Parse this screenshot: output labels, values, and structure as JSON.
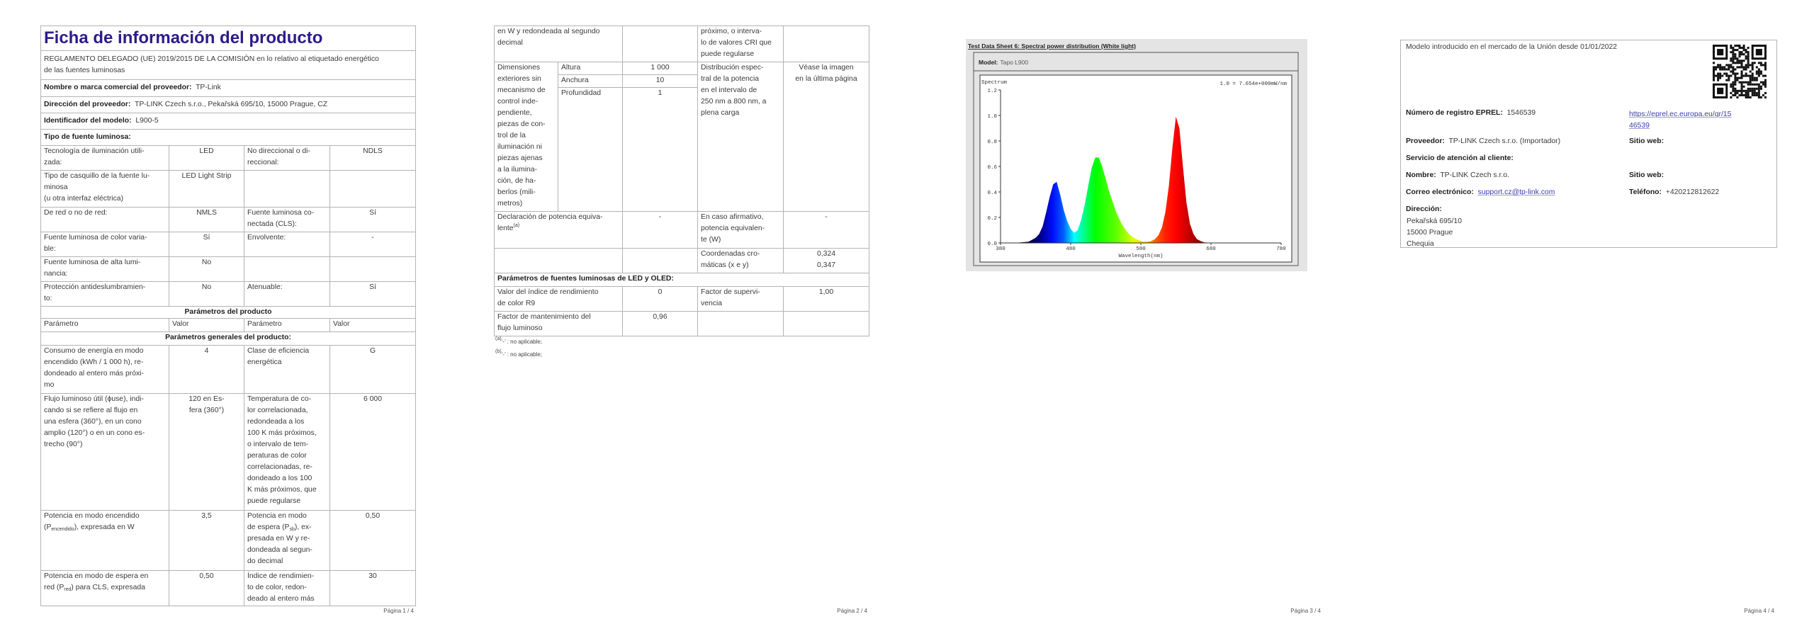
{
  "p1": {
    "title": "Ficha de información del producto",
    "regulation": "REGLAMENTO DELEGADO (UE) 2019/2015 DE LA COMISIÓN en lo relativo al etiquetado energético\nde las fuentes luminosas",
    "supplier_label": "Nombre o marca comercial del proveedor:",
    "supplier": "TP-Link",
    "address_label": "Dirección del proveedor:",
    "address": "TP-LINK Czech s.r.o., Pekařská 695/10, 15000 Prague, CZ",
    "model_label": "Identificador del modelo:",
    "model": "L900-5",
    "type_label": "Tipo de fuente luminosa:",
    "type_rows": [
      [
        "Tecnología de iluminación utili-\nzada:",
        "LED",
        "No direccional o di-\nreccional:",
        "NDLS"
      ],
      [
        "Tipo de casquillo de la fuente lu-\nminosa\n(u otra interfaz eléctrica)",
        "LED Light Strip",
        "",
        ""
      ],
      [
        "De red o no de red:",
        "NMLS",
        "Fuente luminosa co-\nnectada (CLS):",
        "Sí"
      ],
      [
        "Fuente luminosa de color varia-\nble:",
        "Sí",
        "Envolvente:",
        "-"
      ],
      [
        "Fuente luminosa de alta lumi-\nnancia:",
        "No",
        "",
        ""
      ],
      [
        "Protección antideslumbramien-\nto:",
        "No",
        "Atenuable:",
        "Sí"
      ]
    ],
    "params_title": "Parámetros del producto",
    "params_header": [
      "Parámetro",
      "Valor",
      "Parámetro",
      "Valor"
    ],
    "general_title": "Parámetros generales del producto:",
    "general_rows": [
      [
        "Consumo de energía en modo\nencendido (kWh / 1 000 h), re-\ndondeado al entero más próxi-\nmo",
        "4",
        "Clase de eficiencia\nenergética",
        "G"
      ],
      [
        "Flujo luminoso útil (ϕuse), indi-\ncando si se refiere al flujo en\nuna esfera (360°), en un cono\namplio (120°) o en un cono es-\ntrecho (90°)",
        "120 en Es-\nfera (360°)",
        "Temperatura de co-\nlor correlacionada,\nredondeada a los\n100 K más próximos,\no intervalo de tem-\nperaturas de color\ncorrelacionadas, re-\ndondeado a los 100\nK más próximos, que\npuede regularse",
        "6 000"
      ],
      [
        {
          "pre": "Potencia en modo encendido\n(P",
          "sub": "encendido",
          "post": "), expresada en W"
        },
        "3,5",
        {
          "pre": "Potencia en modo\nde espera (P",
          "sub": "sb",
          "post": "), ex-\npresada en W y re-\ndondeada al segun-\ndo decimal"
        },
        "0,50"
      ],
      [
        {
          "pre": "Potencia en modo de espera en\nred (P",
          "sub": "red",
          "post": ") para CLS, expresada"
        },
        "0,50",
        "Índice de rendimien-\nto de color, redon-\ndeado al entero más",
        "30"
      ]
    ],
    "footer": "Página 1 / 4"
  },
  "p2": {
    "cont_row": [
      "en W y redondeada al segundo\ndecimal",
      "",
      "próximo, o interva-\nlo de valores CRI que\npuede regularse",
      ""
    ],
    "dimensions_label": "Dimensiones\nexteriores sin\nmecanismo de\ncontrol inde-\npendiente,\npiezas de con-\ntrol de la\niluminación ni\npiezas ajenas\na la ilumina-\nción, de ha-\nberlos (mili-\nmetros)",
    "dimensions": [
      {
        "label": "Altura",
        "value": "1 000"
      },
      {
        "label": "Anchura",
        "value": "10"
      },
      {
        "label": "Profundidad",
        "value": "1"
      }
    ],
    "spd_label": "Distribución espec-\ntral de la potencia\nen el intervalo de\n250 nm a 800 nm, a\nplena carga",
    "spd_value": "Véase la imagen\nen la última página",
    "equiv_label": "Declaración de potencia equiva-\nlente",
    "equiv_sup": "(a)",
    "equiv_value": "-",
    "equiv_w_label": "En caso afirmativo,\npotencia equivalen-\nte (W)",
    "equiv_w_value": "-",
    "chroma_label": "Coordenadas cro-\nmáticas (x e y)",
    "chroma_value": "0,324\n0,347",
    "led_title": "Parámetros de fuentes luminosas de LED y OLED:",
    "led_rows": [
      [
        "Valor del índice de rendimiento\nde color R9",
        "0",
        "Factor de supervi-\nvencia",
        "1,00"
      ],
      [
        "Factor de mantenimiento del\nflujo luminoso",
        "0,96",
        "",
        ""
      ]
    ],
    "footnotes": [
      {
        "mark": "(a)",
        "text": "‘-’ : no aplicable;"
      },
      {
        "mark": "(b)",
        "text": "‘-’ : no aplicable;"
      }
    ],
    "footer": "Página 2 / 4"
  },
  "p3": {
    "sheet_title": "Test Data Sheet 6: Spectral power distribution (White light)",
    "model_label": "Model:",
    "model_value": "Tapo L900",
    "footer": "Página 3 / 4"
  },
  "chart_data": {
    "type": "area",
    "title": "Spectrum",
    "annotation": "1.0 = 7.654e+000mW/nm",
    "xlabel": "Wavelength(nm)",
    "ylabel": "Spectrum",
    "xlim": [
      380,
      780
    ],
    "ylim": [
      0,
      1.2
    ],
    "xticks": [
      "380",
      "480",
      "580",
      "680",
      "780"
    ],
    "yticks": [
      "0.0",
      "0.2",
      "0.4",
      "0.6",
      "0.8",
      "1.0",
      "1.2"
    ],
    "grid": false,
    "x": [
      400,
      410,
      420,
      430,
      435,
      440,
      445,
      450,
      455,
      460,
      465,
      470,
      475,
      480,
      485,
      490,
      495,
      500,
      505,
      510,
      515,
      520,
      525,
      530,
      535,
      540,
      545,
      550,
      555,
      560,
      565,
      570,
      575,
      580,
      585,
      590,
      595,
      600,
      605,
      610,
      615,
      620,
      625,
      630,
      635,
      640,
      645,
      650,
      655,
      660,
      665,
      670,
      680
    ],
    "y": [
      0,
      0.005,
      0.01,
      0.04,
      0.07,
      0.13,
      0.24,
      0.36,
      0.46,
      0.48,
      0.38,
      0.26,
      0.17,
      0.11,
      0.08,
      0.1,
      0.18,
      0.3,
      0.45,
      0.59,
      0.67,
      0.67,
      0.6,
      0.5,
      0.4,
      0.32,
      0.24,
      0.18,
      0.13,
      0.09,
      0.06,
      0.04,
      0.025,
      0.015,
      0.01,
      0.01,
      0.015,
      0.03,
      0.06,
      0.12,
      0.24,
      0.45,
      0.75,
      0.99,
      0.9,
      0.6,
      0.32,
      0.15,
      0.07,
      0.03,
      0.015,
      0.005,
      0
    ]
  },
  "p4": {
    "market_text": "Modelo introducido en el mercado de la Unión desde 01/01/2022",
    "eprel_label": "Número de registro EPREL:",
    "eprel_value": "1546539",
    "eprel_link_1": "https://eprel.ec.europa.eu/qr/15",
    "eprel_link_2": "46539",
    "supplier_label": "Proveedor:",
    "supplier_value": "TP-LINK Czech s.r.o. (Importador)",
    "website_label_1": "Sitio web:",
    "service_label": "Servicio de atención al cliente:",
    "name_label": "Nombre:",
    "name_value": "TP-LINK Czech s.r.o.",
    "website_label_2": "Sitio web:",
    "email_label": "Correo electrónico:",
    "email_value": "support.cz@tp-link.com",
    "phone_label": "Teléfono:",
    "phone_value": "+420212812622",
    "address_label": "Dirección:",
    "address_lines": [
      "Pekařská 695/10",
      "15000 Prague",
      "Chequia"
    ],
    "footer": "Página 4 / 4"
  },
  "colors": {
    "title": "#2c1b8a",
    "link": "#3b3bb0",
    "border": "#b3b3b3"
  }
}
